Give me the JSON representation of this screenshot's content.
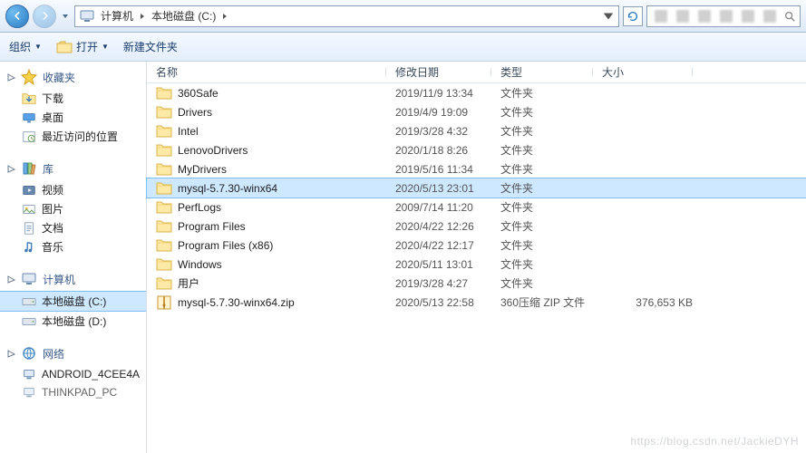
{
  "addr": {
    "crumbs": [
      "计算机",
      "本地磁盘 (C:)"
    ]
  },
  "toolbar": {
    "organize": "组织",
    "open": "打开",
    "newFolder": "新建文件夹"
  },
  "nav": {
    "favorites": {
      "label": "收藏夹",
      "items": [
        {
          "icon": "download",
          "label": "下载"
        },
        {
          "icon": "desktop",
          "label": "桌面"
        },
        {
          "icon": "recent",
          "label": "最近访问的位置"
        }
      ]
    },
    "libraries": {
      "label": "库",
      "items": [
        {
          "icon": "video",
          "label": "视频"
        },
        {
          "icon": "picture",
          "label": "图片"
        },
        {
          "icon": "document",
          "label": "文档"
        },
        {
          "icon": "music",
          "label": "音乐"
        }
      ]
    },
    "computer": {
      "label": "计算机",
      "items": [
        {
          "icon": "drive",
          "label": "本地磁盘 (C:)",
          "selected": true
        },
        {
          "icon": "drive",
          "label": "本地磁盘 (D:)"
        }
      ]
    },
    "network": {
      "label": "网络",
      "items": [
        {
          "icon": "pc",
          "label": "ANDROID_4CEE4A"
        },
        {
          "icon": "pc",
          "label": "THINKPAD_PC",
          "cut": true
        }
      ]
    }
  },
  "columns": {
    "name": "名称",
    "date": "修改日期",
    "type": "类型",
    "size": "大小"
  },
  "files": [
    {
      "icon": "folder",
      "name": "360Safe",
      "date": "2019/11/9 13:34",
      "type": "文件夹",
      "size": ""
    },
    {
      "icon": "folder",
      "name": "Drivers",
      "date": "2019/4/9 19:09",
      "type": "文件夹",
      "size": ""
    },
    {
      "icon": "folder",
      "name": "Intel",
      "date": "2019/3/28 4:32",
      "type": "文件夹",
      "size": ""
    },
    {
      "icon": "folder",
      "name": "LenovoDrivers",
      "date": "2020/1/18 8:26",
      "type": "文件夹",
      "size": ""
    },
    {
      "icon": "folder",
      "name": "MyDrivers",
      "date": "2019/5/16 11:34",
      "type": "文件夹",
      "size": ""
    },
    {
      "icon": "folder",
      "name": "mysql-5.7.30-winx64",
      "date": "2020/5/13 23:01",
      "type": "文件夹",
      "size": "",
      "selected": true
    },
    {
      "icon": "folder",
      "name": "PerfLogs",
      "date": "2009/7/14 11:20",
      "type": "文件夹",
      "size": ""
    },
    {
      "icon": "folder",
      "name": "Program Files",
      "date": "2020/4/22 12:26",
      "type": "文件夹",
      "size": ""
    },
    {
      "icon": "folder",
      "name": "Program Files (x86)",
      "date": "2020/4/22 12:17",
      "type": "文件夹",
      "size": ""
    },
    {
      "icon": "folder",
      "name": "Windows",
      "date": "2020/5/11 13:01",
      "type": "文件夹",
      "size": ""
    },
    {
      "icon": "folder",
      "name": "用户",
      "date": "2019/3/28 4:27",
      "type": "文件夹",
      "size": ""
    },
    {
      "icon": "zip",
      "name": "mysql-5.7.30-winx64.zip",
      "date": "2020/5/13 22:58",
      "type": "360压缩 ZIP 文件",
      "size": "376,653 KB"
    }
  ],
  "watermark": "https://blog.csdn.net/JackieDYH"
}
